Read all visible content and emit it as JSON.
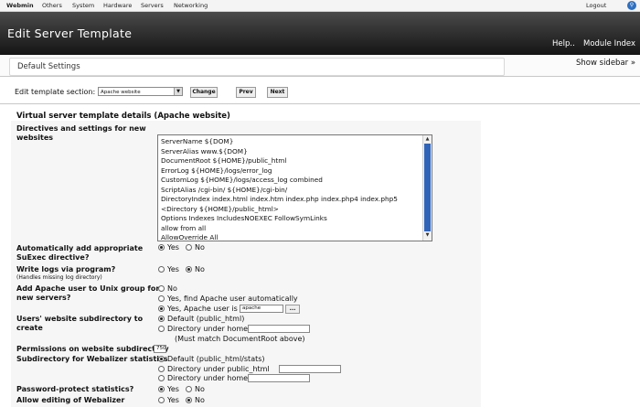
{
  "topnav": {
    "items": [
      "Webmin",
      "Others",
      "System",
      "Hardware",
      "Servers",
      "Networking"
    ],
    "logout": "Logout",
    "search_icon": "search-icon"
  },
  "header": {
    "title": "Edit Server Template",
    "help": "Help..",
    "module_index": "Module Index"
  },
  "settings_bar": {
    "label": "Default Settings",
    "show_sidebar": "Show sidebar »"
  },
  "section_selector": {
    "label": "Edit template section:",
    "selected": "Apache website",
    "change_button": "Change",
    "prev_button": "Prev",
    "next_button": "Next"
  },
  "details": {
    "heading": "Virtual server template details (Apache website)",
    "directives_label_1": "Directives and settings for new",
    "directives_label_2": "websites",
    "directives": [
      "ServerName ${DOM}",
      "ServerAlias www.${DOM}",
      "DocumentRoot ${HOME}/public_html",
      "ErrorLog ${HOME}/logs/error_log",
      "CustomLog ${HOME}/logs/access_log combined",
      "ScriptAlias /cgi-bin/ ${HOME}/cgi-bin/",
      "DirectoryIndex index.html index.htm index.php index.php4 index.php5",
      "<Directory ${HOME}/public_html>",
      "Options Indexes IncludesNOEXEC FollowSymLinks",
      "allow from all",
      "AllowOverride All"
    ],
    "suexec": {
      "label_1": "Automatically add appropriate",
      "label_2": "SuExec directive?",
      "yes": "Yes",
      "no": "No",
      "selected": "yes"
    },
    "write_logs": {
      "label": "Write logs via program?",
      "sublabel": "(Handles missing log directory)",
      "yes": "Yes",
      "no": "No",
      "selected": "no"
    },
    "apache_group": {
      "label_1": "Add Apache user to Unix group for",
      "label_2": "new servers?",
      "opt_no": "No",
      "opt_auto": "Yes, find Apache user automatically",
      "opt_user": "Yes, Apache user is",
      "user_value": "apache",
      "browse": "...",
      "selected": "user"
    },
    "website_subdir": {
      "label_1": "Users' website subdirectory to",
      "label_2": "create",
      "opt_default": "Default (public_html)",
      "opt_dir": "Directory under home",
      "note": "(Must match DocumentRoot above)",
      "selected": "default"
    },
    "permissions": {
      "label": "Permissions on website subdirectory",
      "value": "750"
    },
    "webalizer_subdir": {
      "label": "Subdirectory for Webalizer statistics",
      "opt_default": "Default (public_html/stats)",
      "opt_public": "Directory under public_html",
      "opt_home": "Directory under home",
      "selected": "default"
    },
    "password_protect": {
      "label": "Password-protect statistics?",
      "yes": "Yes",
      "no": "No",
      "selected": "yes"
    },
    "webalizer_edit": {
      "label": "Allow editing of Webalizer",
      "yes": "Yes",
      "no": "No",
      "selected": "no"
    }
  }
}
